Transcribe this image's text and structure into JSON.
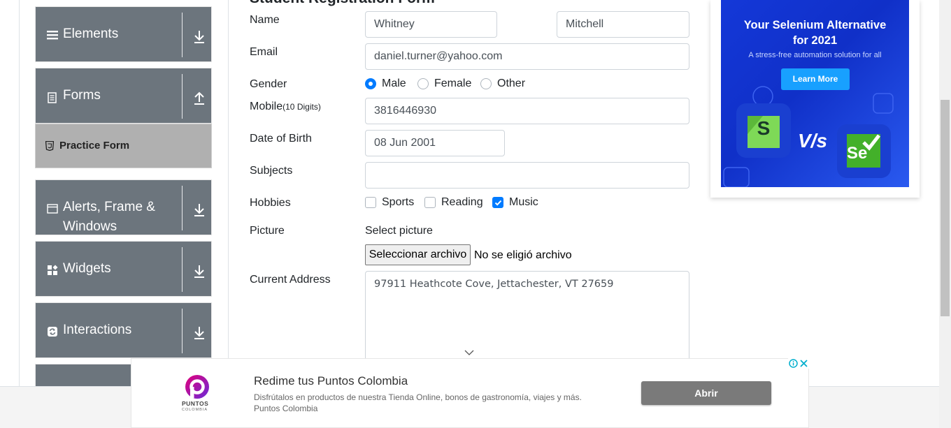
{
  "sidebar": {
    "groups": [
      {
        "label": "Elements",
        "icon": "hamburger-icon",
        "arrow": "download-arrow-icon"
      },
      {
        "label": "Forms",
        "icon": "document-icon",
        "arrow": "upload-arrow-icon"
      },
      {
        "label": "Alerts, Frame &",
        "label2": "Windows",
        "icon": "window-icon",
        "arrow": "download-arrow-icon"
      },
      {
        "label": "Widgets",
        "icon": "widgets-icon",
        "arrow": "download-arrow-icon"
      },
      {
        "label": "Interactions",
        "icon": "interactions-icon",
        "arrow": "download-arrow-icon"
      }
    ],
    "active_item": "Practice Form"
  },
  "form": {
    "title": "Student Registration Form",
    "labels": {
      "name": "Name",
      "email": "Email",
      "gender": "Gender",
      "mobile": "Mobile",
      "mobile_hint": "(10 Digits)",
      "dob": "Date of Birth",
      "subjects": "Subjects",
      "hobbies": "Hobbies",
      "picture": "Picture",
      "address": "Current Address"
    },
    "first_name": "Whitney",
    "last_name": "Mitchell",
    "email": "daniel.turner@yahoo.com",
    "gender_options": [
      {
        "label": "Male",
        "checked": true
      },
      {
        "label": "Female",
        "checked": false
      },
      {
        "label": "Other",
        "checked": false
      }
    ],
    "mobile": "3816446930",
    "dob": "08 Jun 2001",
    "subjects": "",
    "hobbies": [
      {
        "label": "Sports",
        "checked": false
      },
      {
        "label": "Reading",
        "checked": false
      },
      {
        "label": "Music",
        "checked": true
      }
    ],
    "picture_label": "Select picture",
    "file_button": "Seleccionar archivo",
    "file_status": "No se eligió archivo",
    "address": "97911 Heathcote Cove, Jettachester, VT 27659"
  },
  "ad_right": {
    "title_line1": "Your Selenium Alternative",
    "title_line2": "for 2021",
    "subtitle": "A stress-free automation solution for all",
    "cta": "Learn More",
    "vs": "V/s",
    "logo_left": "S",
    "logo_right": "Se"
  },
  "ad_bottom": {
    "title": "Redime tus Puntos Colombia",
    "description": "Disfrútalos en productos de nuestra Tienda Online, bonos de gastronomía, viajes y más.",
    "advertiser": "Puntos Colombia",
    "cta": "Abrir",
    "logo_text": "PUNTOS",
    "logo_sub": "COLOMBIA"
  },
  "colors": {
    "sidebar": "#6c757d",
    "active": "#b0b0b0",
    "accent": "#007bff",
    "ad_blue": "#1438d8"
  }
}
